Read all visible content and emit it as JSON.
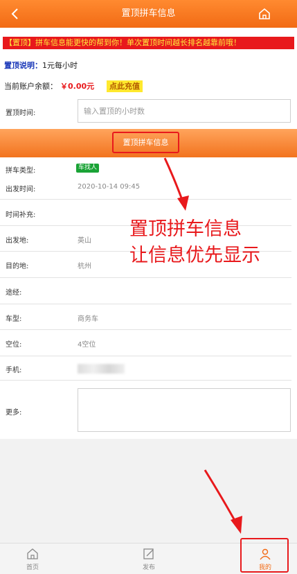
{
  "header": {
    "title": "置顶拼车信息",
    "back_icon": "chevron-left-icon",
    "home_icon": "home-icon"
  },
  "notice": "【置顶】拼车信息能更快的帮到你！单次置顶时间越长排名越靠前哦！",
  "pin_desc": {
    "label": "置顶说明：",
    "value": "1元每小时"
  },
  "balance": {
    "label": "当前账户余额：",
    "amount": "￥0.00元",
    "recharge_label": "点此充值"
  },
  "pin_time": {
    "label": "置顶时间:",
    "placeholder": "输入置顶的小时数"
  },
  "submit_label": "置顶拼车信息",
  "details": [
    {
      "label": "拼车类型:",
      "value": "车找人"
    },
    {
      "label": "出发时间:",
      "value": "2020-10-14 09:45"
    },
    {
      "label": "时间补充:",
      "value": ""
    },
    {
      "label": "出发地:",
      "value": "英山"
    },
    {
      "label": "目的地:",
      "value": "杭州"
    },
    {
      "label": "途经:",
      "value": ""
    },
    {
      "label": "车型:",
      "value": "商务车"
    },
    {
      "label": "空位:",
      "value": "4空位"
    },
    {
      "label": "手机:",
      "value": ""
    },
    {
      "label": "更多:",
      "value": ""
    }
  ],
  "annotation": {
    "line1": "置顶拼车信息",
    "line2": "让信息优先显示"
  },
  "tabs": [
    {
      "label": "首页",
      "icon": "home-icon"
    },
    {
      "label": "发布",
      "icon": "edit-icon"
    },
    {
      "label": "我的",
      "icon": "user-icon"
    }
  ],
  "colors": {
    "primary": "#f26a14",
    "notice_bg": "#e8191c",
    "notice_text": "#ffec3d",
    "tag_bg": "#1aa336"
  }
}
